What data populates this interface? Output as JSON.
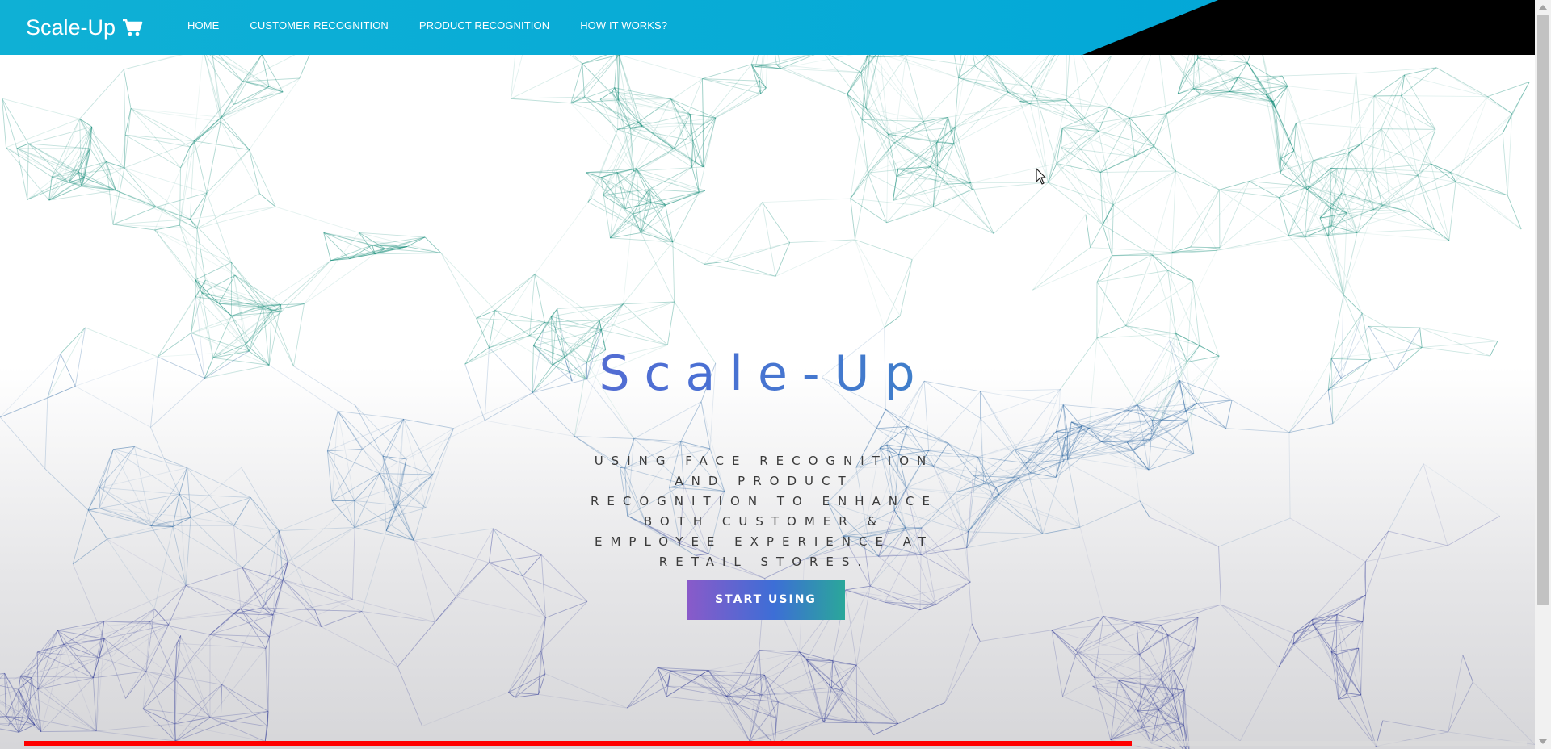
{
  "navbar": {
    "brand": "Scale-Up",
    "brand_icon": "cart-icon",
    "links": [
      "HOME",
      "CUSTOMER RECOGNITION",
      "PRODUCT RECOGNITION",
      "HOW IT WORKS?"
    ]
  },
  "hero": {
    "title": "Scale-Up",
    "subtitle": "Using face recognition and product recognition to enhance both customer & employee experience at retail stores.",
    "cta_label": "START USING"
  },
  "video": {
    "progress": 0.737
  },
  "colors": {
    "nav_bg": "#00a6d8",
    "accent_purple": "#8a5cc8",
    "accent_blue": "#4b6fd4",
    "accent_teal": "#1fa6b0",
    "progress": "#ff0000"
  }
}
